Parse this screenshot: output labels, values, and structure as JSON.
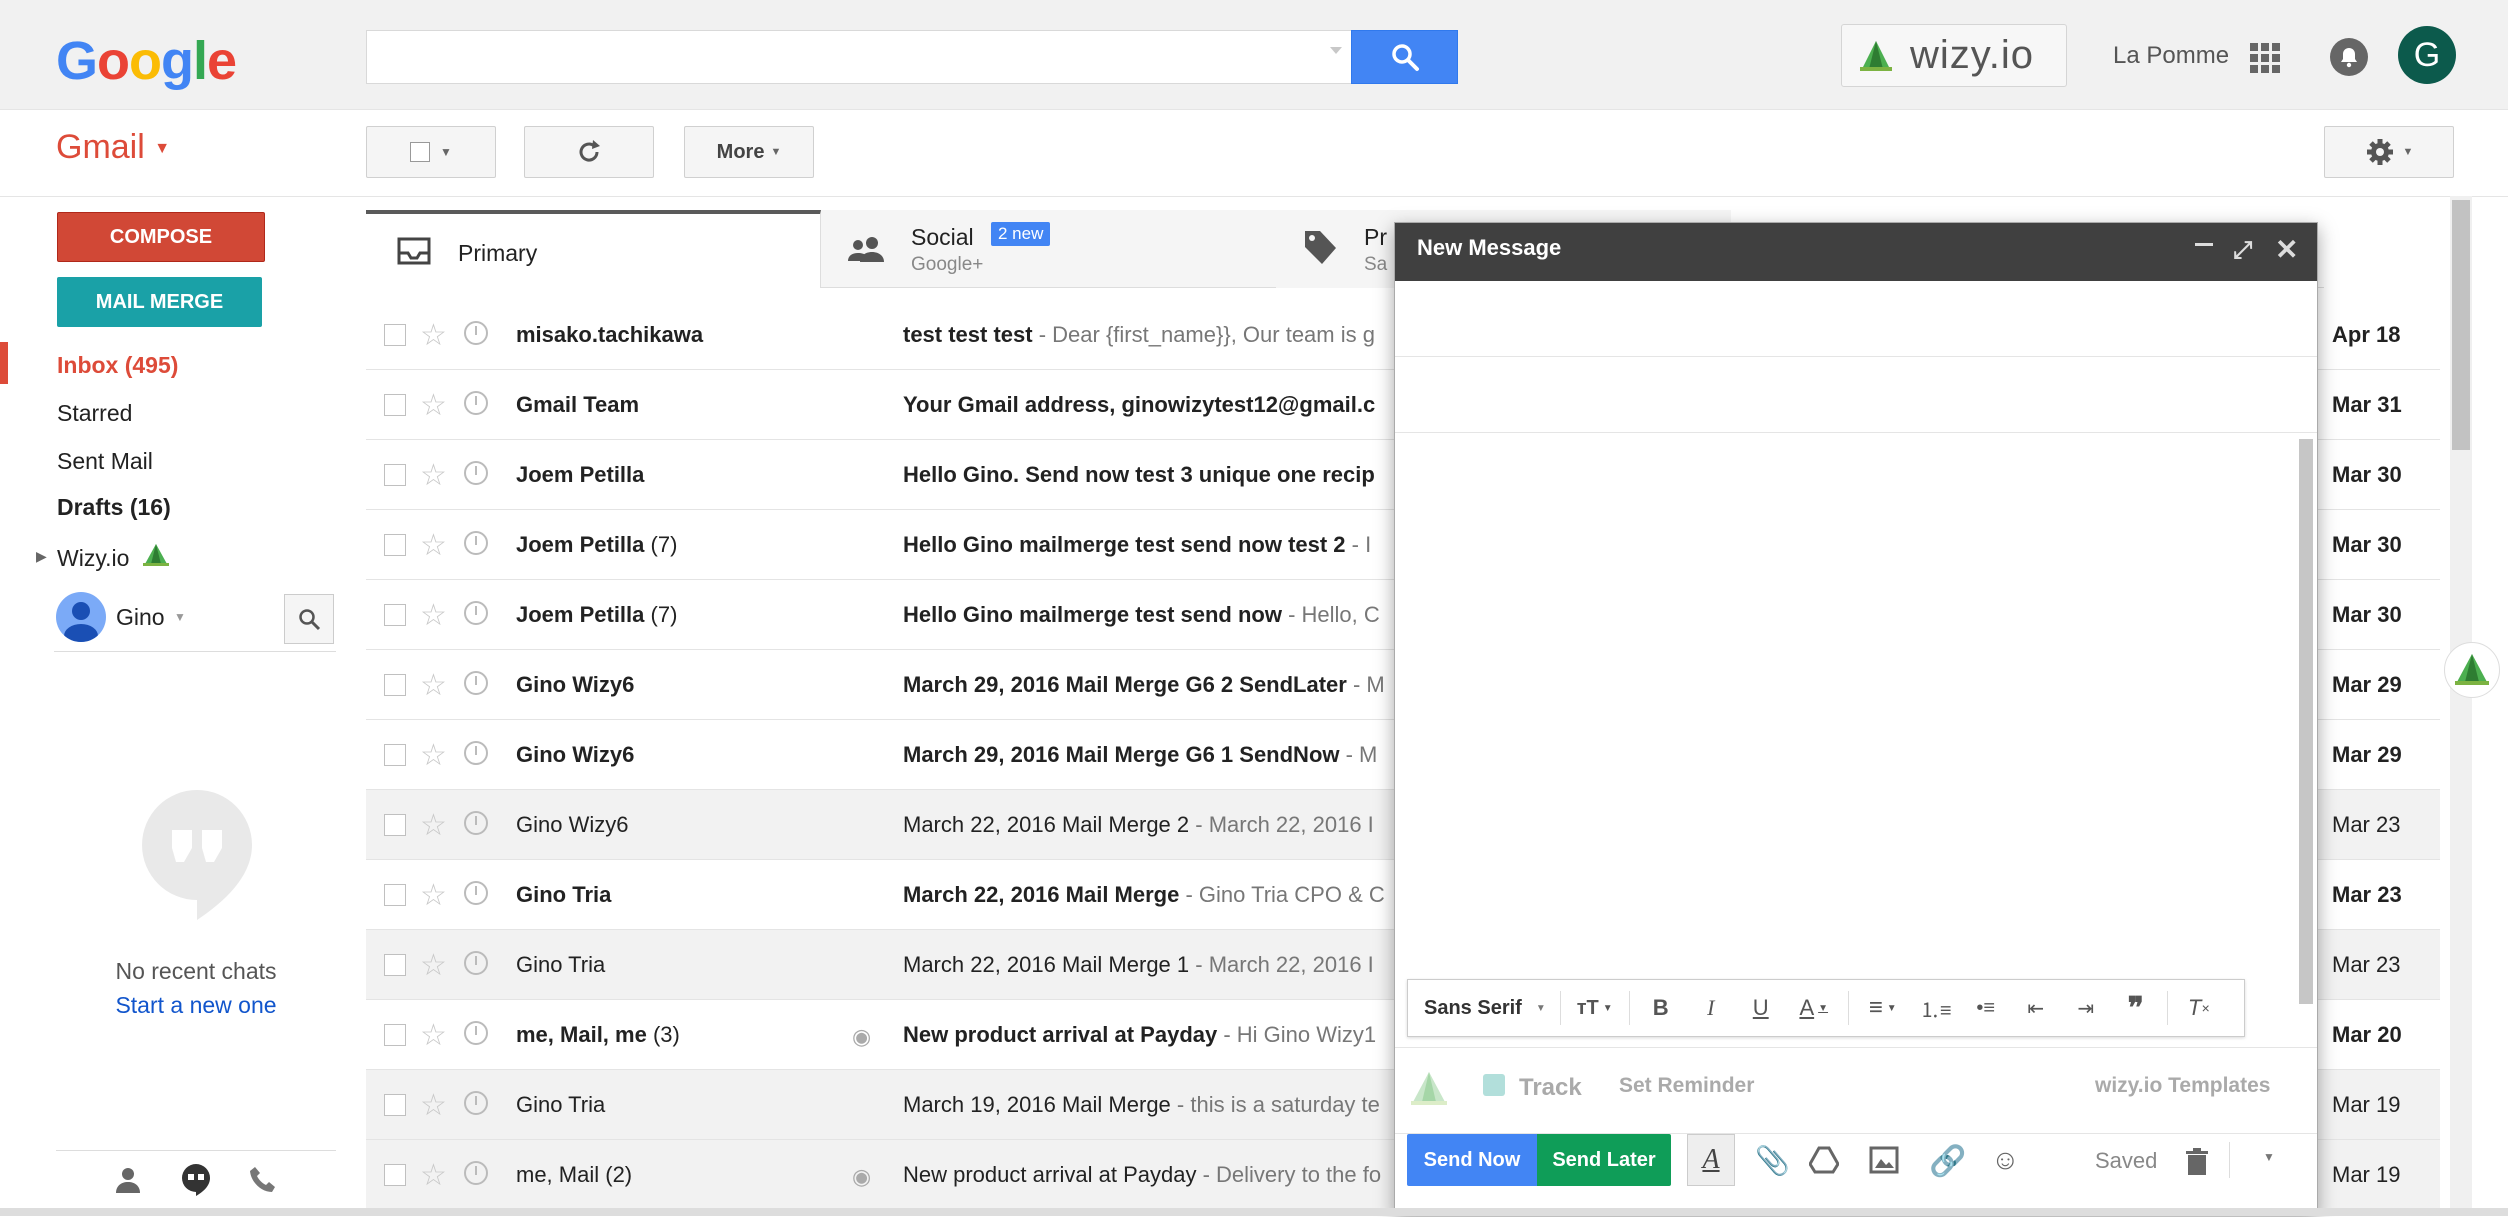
{
  "header": {
    "logo": [
      "G",
      "o",
      "o",
      "g",
      "l",
      "e"
    ],
    "logo_colors": [
      "#4285f4",
      "#ea4335",
      "#fbbc05",
      "#4285f4",
      "#34a853",
      "#ea4335"
    ],
    "search_placeholder": "",
    "wizy_label": "wizy.io",
    "user_name": "La Pomme",
    "avatar_letter": "G"
  },
  "toolbar": {
    "gmail_label": "Gmail",
    "more_label": "More"
  },
  "sidebar": {
    "compose_label": "COMPOSE",
    "mailmerge_label": "MAIL MERGE",
    "items": [
      {
        "label": "Inbox (495)"
      },
      {
        "label": "Starred"
      },
      {
        "label": "Sent Mail"
      },
      {
        "label": "Drafts (16)"
      },
      {
        "label": "Wizy.io"
      }
    ],
    "chat_user": "Gino",
    "no_chats": "No recent chats",
    "start_new": "Start a new one"
  },
  "tabs": [
    {
      "label": "Primary",
      "sub": ""
    },
    {
      "label": "Social",
      "sub": "Google+",
      "badge": "2 new"
    },
    {
      "label": "Pr",
      "sub": "Sa"
    }
  ],
  "emails": [
    {
      "sender": "misako.tachikawa",
      "count": "",
      "subject": "test test test",
      "snippet": " - Dear {first_name}}, Our team is g",
      "date": "Apr 18",
      "unread": true,
      "eye": false
    },
    {
      "sender": "Gmail Team",
      "count": "",
      "subject": "Your Gmail address, ginowizytest12@gmail.c",
      "snippet": "",
      "date": "Mar 31",
      "unread": true,
      "eye": false
    },
    {
      "sender": "Joem Petilla",
      "count": "",
      "subject": "Hello Gino. Send now test 3 unique one recip",
      "snippet": "",
      "date": "Mar 30",
      "unread": true,
      "eye": false
    },
    {
      "sender": "Joem Petilla",
      "count": " (7)",
      "subject": "Hello Gino mailmerge test send now test 2",
      "snippet": " - I",
      "date": "Mar 30",
      "unread": true,
      "eye": false
    },
    {
      "sender": "Joem Petilla",
      "count": " (7)",
      "subject": "Hello Gino mailmerge test send now",
      "snippet": " - Hello, C",
      "date": "Mar 30",
      "unread": true,
      "eye": false
    },
    {
      "sender": "Gino Wizy6",
      "count": "",
      "subject": "March 29, 2016 Mail Merge G6 2 SendLater",
      "snippet": " - M",
      "date": "Mar 29",
      "unread": true,
      "eye": false
    },
    {
      "sender": "Gino Wizy6",
      "count": "",
      "subject": "March 29, 2016 Mail Merge G6 1 SendNow",
      "snippet": " - M",
      "date": "Mar 29",
      "unread": true,
      "eye": false
    },
    {
      "sender": "Gino Wizy6",
      "count": "",
      "subject": "March 22, 2016 Mail Merge 2",
      "snippet": " - March 22, 2016 I",
      "date": "Mar 23",
      "unread": false,
      "eye": false
    },
    {
      "sender": "Gino Tria",
      "count": "",
      "subject": "March 22, 2016 Mail Merge",
      "snippet": " - Gino Tria CPO & C",
      "date": "Mar 23",
      "unread": true,
      "eye": false
    },
    {
      "sender": "Gino Tria",
      "count": "",
      "subject": "March 22, 2016 Mail Merge 1",
      "snippet": " - March 22, 2016 I",
      "date": "Mar 23",
      "unread": false,
      "eye": false
    },
    {
      "sender": "me, Mail, me",
      "count": " (3)",
      "subject": "New product arrival at Payday",
      "snippet": " - Hi Gino Wizy1",
      "date": "Mar 20",
      "unread": true,
      "eye": true
    },
    {
      "sender": "Gino Tria",
      "count": "",
      "subject": "March 19, 2016 Mail Merge",
      "snippet": " - this is a saturday te",
      "date": "Mar 19",
      "unread": false,
      "eye": false
    },
    {
      "sender": "me, Mail",
      "count": " (2)",
      "subject": "New product arrival at Payday",
      "snippet": " - Delivery to the fo",
      "date": "Mar 19",
      "unread": false,
      "eye": true
    }
  ],
  "compose": {
    "title": "New Message",
    "font_label": "Sans Serif",
    "track_label": "Track",
    "reminder_label": "Set Reminder",
    "templates_label": "wizy.io Templates",
    "send_now_label": "Send Now",
    "send_later_label": "Send Later",
    "saved_label": "Saved"
  }
}
